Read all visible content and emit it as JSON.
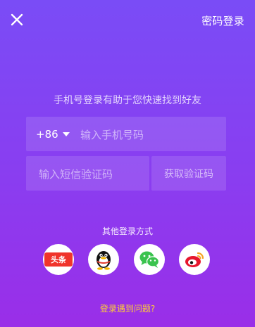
{
  "header": {
    "password_login_label": "密码登录",
    "close_icon": "close-icon"
  },
  "subtitle": "手机号登录有助于您快速找到好友",
  "phone": {
    "country_code": "+86",
    "placeholder": "输入手机号码"
  },
  "sms": {
    "placeholder": "输入短信验证码",
    "get_code_label": "获取验证码"
  },
  "other_login": {
    "label": "其他登录方式",
    "toutiao_label": "头条",
    "providers": [
      "toutiao",
      "qq",
      "wechat",
      "weibo"
    ]
  },
  "help_link": "登录遇到问题?",
  "colors": {
    "gradient_top": "#7a4cf6",
    "gradient_bottom": "#9a2ee8",
    "help_link": "#ffcf33",
    "toutiao_red": "#f0342b",
    "wechat_green": "#3ac34e",
    "weibo_red": "#e6162d",
    "weibo_yellow": "#f5a623"
  }
}
